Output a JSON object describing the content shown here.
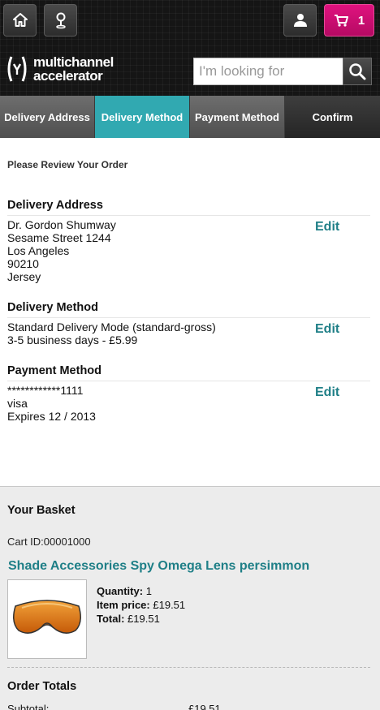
{
  "header": {
    "cart_count": "1",
    "logo_line1": "multichannel",
    "logo_line2": "accelerator",
    "search_placeholder": "I'm looking for",
    "icons": [
      "home-icon",
      "store-locator-icon",
      "account-icon",
      "cart-icon",
      "search-icon"
    ],
    "accent_color": "#d5107a"
  },
  "steps": [
    {
      "label": "Delivery Address",
      "active": false
    },
    {
      "label": "Delivery Method",
      "active": true
    },
    {
      "label": "Payment Method",
      "active": false
    },
    {
      "label": "Confirm",
      "active": false
    }
  ],
  "review": {
    "title": "Please Review Your Order",
    "edit_label": "Edit",
    "delivery_address": {
      "heading": "Delivery Address",
      "lines": [
        "Dr. Gordon Shumway",
        "Sesame Street 1244",
        "Los Angeles",
        "90210",
        "Jersey"
      ]
    },
    "delivery_method": {
      "heading": "Delivery Method",
      "lines": [
        "Standard Delivery Mode (standard-gross)",
        "3-5 business days - £5.99"
      ]
    },
    "payment_method": {
      "heading": "Payment Method",
      "lines": [
        "************1111",
        "visa",
        "Expires 12 / 2013"
      ]
    }
  },
  "basket": {
    "title": "Your Basket",
    "cart_id": "Cart ID:00001000",
    "product": {
      "name": "Shade Accessories Spy Omega Lens persimmon",
      "quantity_label": "Quantity:",
      "quantity": "1",
      "item_price_label": "Item price:",
      "item_price": "£19.51",
      "total_label": "Total:",
      "total": "£19.51"
    },
    "totals_title": "Order Totals",
    "subtotal_label": "Subtotal:",
    "subtotal_value": "£19.51"
  }
}
